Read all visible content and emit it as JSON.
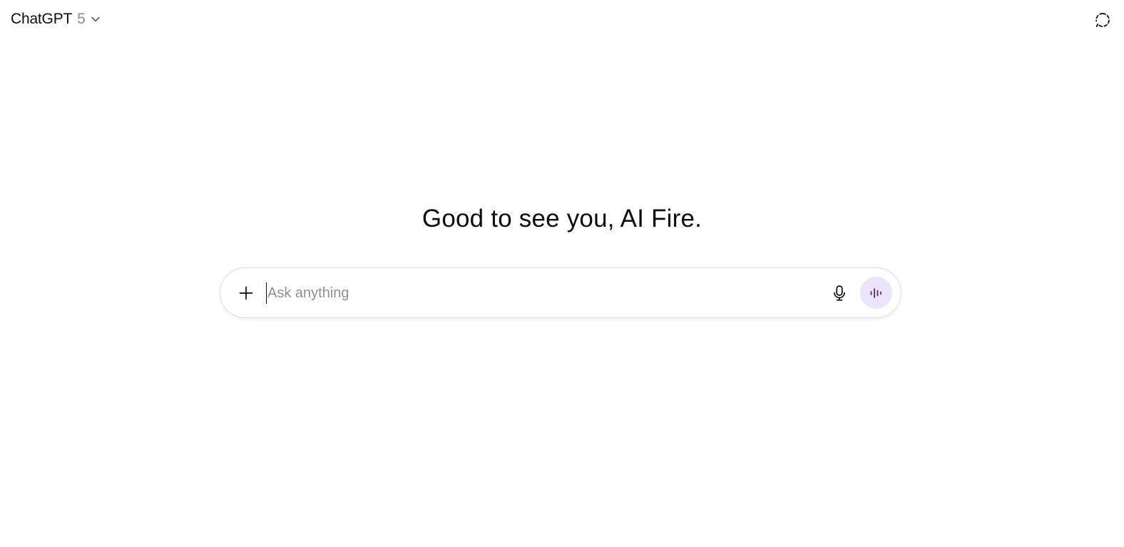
{
  "header": {
    "model_name": "ChatGPT",
    "model_version": "5",
    "model_dropdown_icon": "chevron-down-icon",
    "temporary_chat_icon": "dashed-circle-chat-icon"
  },
  "main": {
    "greeting": "Good to see you, AI Fire."
  },
  "composer": {
    "placeholder": "Ask anything",
    "value": "",
    "add_icon": "plus-icon",
    "dictate_icon": "microphone-icon",
    "voice_mode_icon": "sound-wave-icon"
  },
  "colors": {
    "voice_button_bg": "#ece3fc",
    "voice_icon": "#5b2a86",
    "text": "#0d0d0d",
    "placeholder": "#8f8f8f",
    "version_text": "#8a8a8a"
  }
}
